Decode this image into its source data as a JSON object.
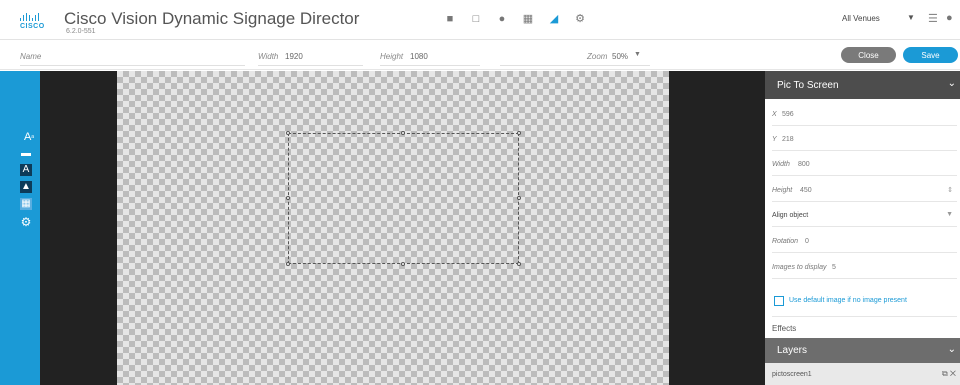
{
  "header": {
    "logo_text": "CISCO",
    "title": "Cisco Vision Dynamic Signage Director",
    "version": "6.2.0-551",
    "venue": "All Venues",
    "toolbar_icons": [
      "folder-icon",
      "monitor-icon",
      "gear-dot-icon",
      "grid-icon",
      "ruler-icon",
      "settings-icon"
    ]
  },
  "subbar": {
    "name_label": "Name",
    "width_label": "Width",
    "width_value": "1920",
    "height_label": "Height",
    "height_value": "1080",
    "zoom_label": "Zoom",
    "zoom_value": "50%",
    "close_label": "Close",
    "save_label": "Save"
  },
  "left_rail_icons": [
    "text-scale-icon",
    "layer-icon",
    "text-icon",
    "image-icon",
    "picture-icon",
    "settings-gear-icon"
  ],
  "panel": {
    "title": "Pic To Screen",
    "x_label": "X",
    "x_value": "596",
    "y_label": "Y",
    "y_value": "218",
    "width_label": "Width",
    "width_value": "800",
    "height_label": "Height",
    "height_value": "450",
    "align_label": "Align object",
    "rotation_label": "Rotation",
    "rotation_value": "0",
    "images_label": "Images to display",
    "images_value": "5",
    "default_image_label": "Use default image if no image present",
    "effects_label": "Effects"
  },
  "layers": {
    "title": "Layers",
    "items": [
      {
        "name": "pictoscreen1"
      }
    ]
  },
  "colors": {
    "accent": "#1b9ad6",
    "panel_header": "#4d4d4d",
    "stage": "#222222"
  }
}
